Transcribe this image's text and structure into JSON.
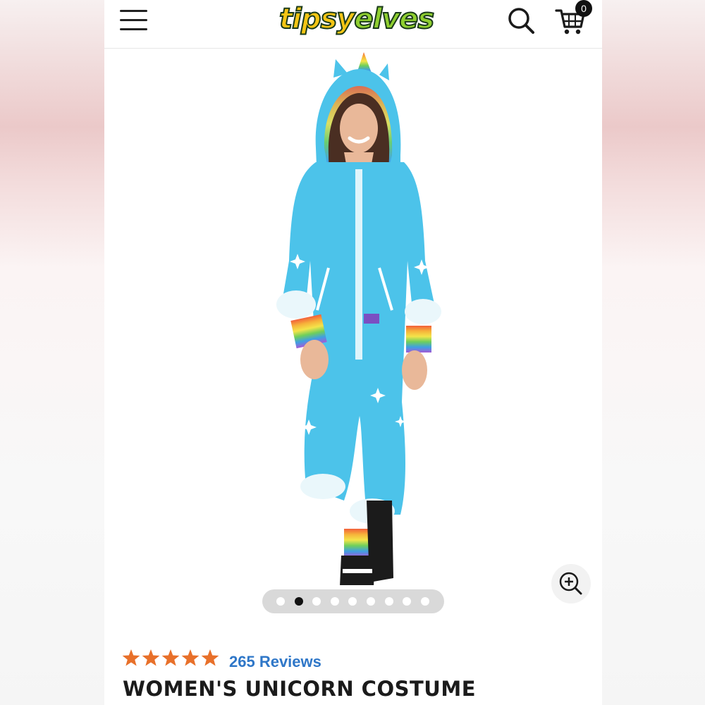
{
  "header": {
    "logo_part1": "tipsy",
    "logo_part2": "elves",
    "cart_count": "0",
    "icons": {
      "menu": "hamburger-menu-icon",
      "search": "search-icon",
      "cart": "cart-icon"
    }
  },
  "gallery": {
    "image_subject": "product-photo-unicorn-jumpsuit",
    "dot_count": 9,
    "active_index": 1,
    "zoom_icon": "zoom-in-icon"
  },
  "product": {
    "rating": 5,
    "rating_max": 5,
    "reviews_label": "265 Reviews",
    "title": "WOMEN'S UNICORN COSTUME"
  },
  "colors": {
    "star": "#e8702a",
    "reviews_link": "#2f77c8",
    "suit": "#4cc3ea",
    "logo_yellow": "#f4c514",
    "logo_green": "#8fcf2f"
  }
}
